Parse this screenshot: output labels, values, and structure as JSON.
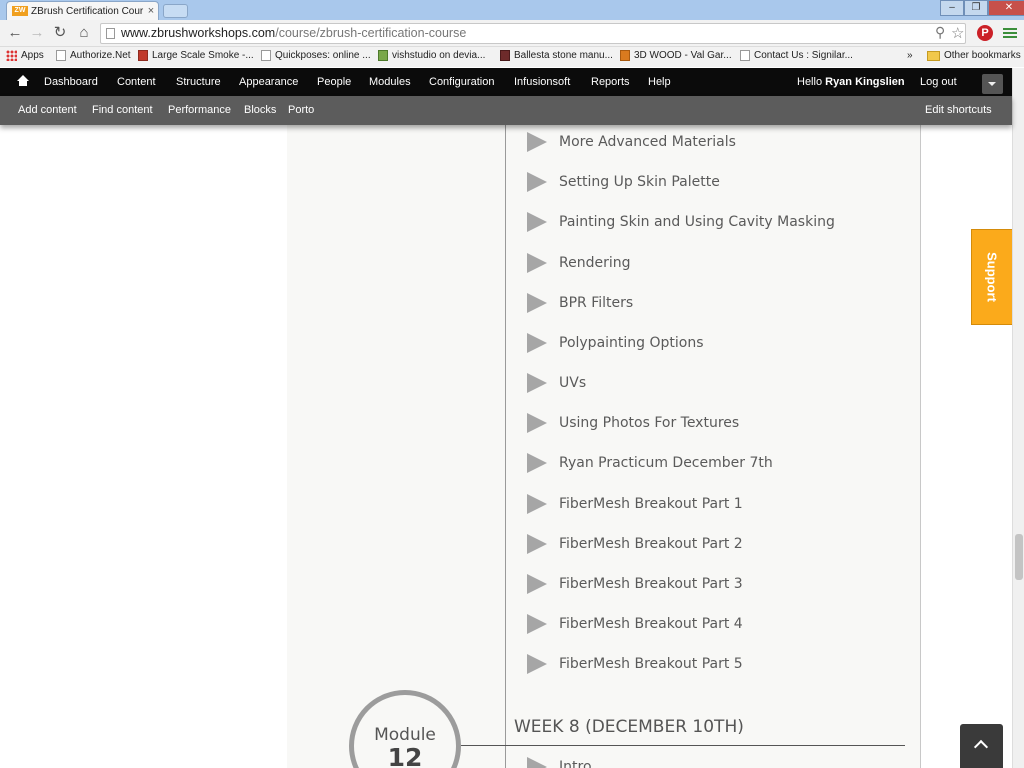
{
  "browser": {
    "tab_title": "ZBrush Certification Cour",
    "tab_favicon_text": "ZW",
    "url_host": "www.zbrushworkshops.com",
    "url_path": "/course/zbrush-certification-course"
  },
  "bookmarks": {
    "items": [
      {
        "label": "Apps",
        "icon": "apps-grid-icon"
      },
      {
        "label": "Authorize.Net",
        "icon": "page-icon"
      },
      {
        "label": "Large Scale Smoke -...",
        "icon": "image-icon"
      },
      {
        "label": "Quickposes: online ...",
        "icon": "page-icon"
      },
      {
        "label": "vishstudio on devia...",
        "icon": "deviantart-icon"
      },
      {
        "label": "Ballesta stone manu...",
        "icon": "book-icon"
      },
      {
        "label": "3D WOOD - Val Gar...",
        "icon": "shield-icon"
      },
      {
        "label": "Contact Us : Signilar...",
        "icon": "page-icon"
      }
    ],
    "overflow": "»",
    "other": "Other bookmarks"
  },
  "admin_toolbar": {
    "items": [
      "Dashboard",
      "Content",
      "Structure",
      "Appearance",
      "People",
      "Modules",
      "Configuration",
      "Infusionsoft",
      "Reports",
      "Help"
    ],
    "hello_prefix": "Hello ",
    "user_name": "Ryan Kingslien",
    "logout": "Log out"
  },
  "shortcuts": {
    "items": [
      "Add content",
      "Find content",
      "Performance",
      "Blocks",
      "Porto"
    ],
    "edit": "Edit shortcuts"
  },
  "lessons": [
    "More Advanced Materials",
    "Setting Up Skin Palette",
    "Painting Skin and Using Cavity Masking",
    "Rendering",
    "BPR Filters",
    "Polypainting Options",
    "UVs",
    "Using Photos For Textures",
    "Ryan Practicum December 7th",
    "FiberMesh Breakout Part 1",
    "FiberMesh Breakout Part 2",
    "FiberMesh Breakout Part 3",
    "FiberMesh Breakout Part 4",
    "FiberMesh Breakout Part 5"
  ],
  "module": {
    "label": "Module",
    "number": "12",
    "week_heading": "WEEK 8 (DECEMBER 10TH)",
    "next_lesson": "Intro"
  },
  "support_label": "Support",
  "colors": {
    "admin_bar": "#0b0b0b",
    "shortcut_bar": "#5c5c5c",
    "support": "#fbaa1b",
    "play_icon": "#a6a6a6",
    "lesson_text": "#5a5a5a"
  }
}
